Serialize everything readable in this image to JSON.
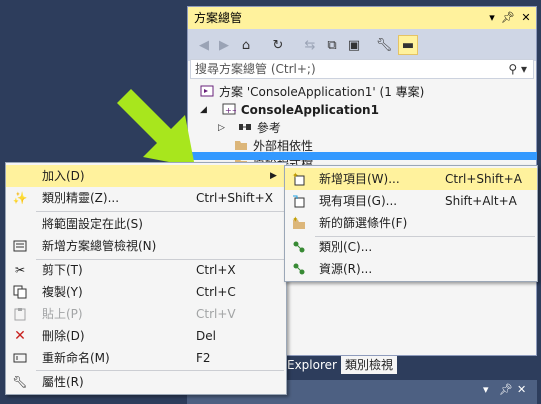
{
  "solution_explorer": {
    "title": "方案總管",
    "search_placeholder": "搜尋方案總管 (Ctrl+;)",
    "tree": {
      "solution": "方案 'ConsoleApplication1' (1 專案)",
      "project": "ConsoleApplication1",
      "references": "參考",
      "external_deps": "外部相依性",
      "source_files": "原始程式檔"
    },
    "bottom_tabs": {
      "explorer": "Explorer",
      "class_view": "類別檢視"
    }
  },
  "context_menu": {
    "items": [
      {
        "label": "加入(D)",
        "shortcut": ""
      },
      {
        "label": "類別精靈(Z)...",
        "shortcut": "Ctrl+Shift+X"
      },
      {
        "label": "將範圍設定在此(S)",
        "shortcut": ""
      },
      {
        "label": "新增方案總管檢視(N)",
        "shortcut": ""
      },
      {
        "label": "剪下(T)",
        "shortcut": "Ctrl+X"
      },
      {
        "label": "複製(Y)",
        "shortcut": "Ctrl+C"
      },
      {
        "label": "貼上(P)",
        "shortcut": "Ctrl+V"
      },
      {
        "label": "刪除(D)",
        "shortcut": "Del"
      },
      {
        "label": "重新命名(M)",
        "shortcut": "F2"
      },
      {
        "label": "屬性(R)",
        "shortcut": ""
      }
    ]
  },
  "submenu": {
    "items": [
      {
        "label": "新增項目(W)...",
        "shortcut": "Ctrl+Shift+A"
      },
      {
        "label": "現有項目(G)...",
        "shortcut": "Shift+Alt+A"
      },
      {
        "label": "新的篩選條件(F)",
        "shortcut": ""
      },
      {
        "label": "類別(C)...",
        "shortcut": ""
      },
      {
        "label": "資源(R)...",
        "shortcut": ""
      }
    ]
  },
  "colors": {
    "highlight": "#fff29d",
    "arrow": "#a8e61d",
    "selection": "#3399ff",
    "background": "#2d3d5c"
  }
}
